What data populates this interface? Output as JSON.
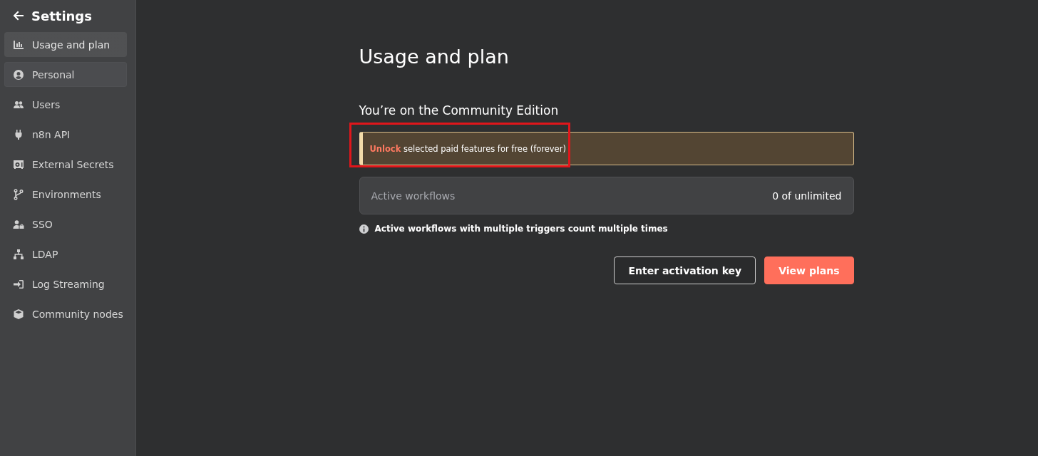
{
  "sidebar": {
    "title": "Settings",
    "items": [
      {
        "label": "Usage and plan",
        "selected": true,
        "hovered": false
      },
      {
        "label": "Personal",
        "selected": false,
        "hovered": true
      },
      {
        "label": "Users",
        "selected": false,
        "hovered": false
      },
      {
        "label": "n8n API",
        "selected": false,
        "hovered": false
      },
      {
        "label": "External Secrets",
        "selected": false,
        "hovered": false
      },
      {
        "label": "Environments",
        "selected": false,
        "hovered": false
      },
      {
        "label": "SSO",
        "selected": false,
        "hovered": false
      },
      {
        "label": "LDAP",
        "selected": false,
        "hovered": false
      },
      {
        "label": "Log Streaming",
        "selected": false,
        "hovered": false
      },
      {
        "label": "Community nodes",
        "selected": false,
        "hovered": false
      }
    ]
  },
  "page": {
    "title": "Usage and plan",
    "subtitle": "You’re on the Community Edition",
    "callout": {
      "link": "Unlock",
      "text": "selected paid features for free (forever)",
      "highlighted": true
    },
    "usage": {
      "label": "Active workflows",
      "value": "0 of unlimited"
    },
    "info": "Active workflows with multiple triggers count multiple times",
    "buttons": [
      {
        "label": "Enter activation key",
        "kind": "secondary"
      },
      {
        "label": "View plans",
        "kind": "primary"
      }
    ]
  }
}
